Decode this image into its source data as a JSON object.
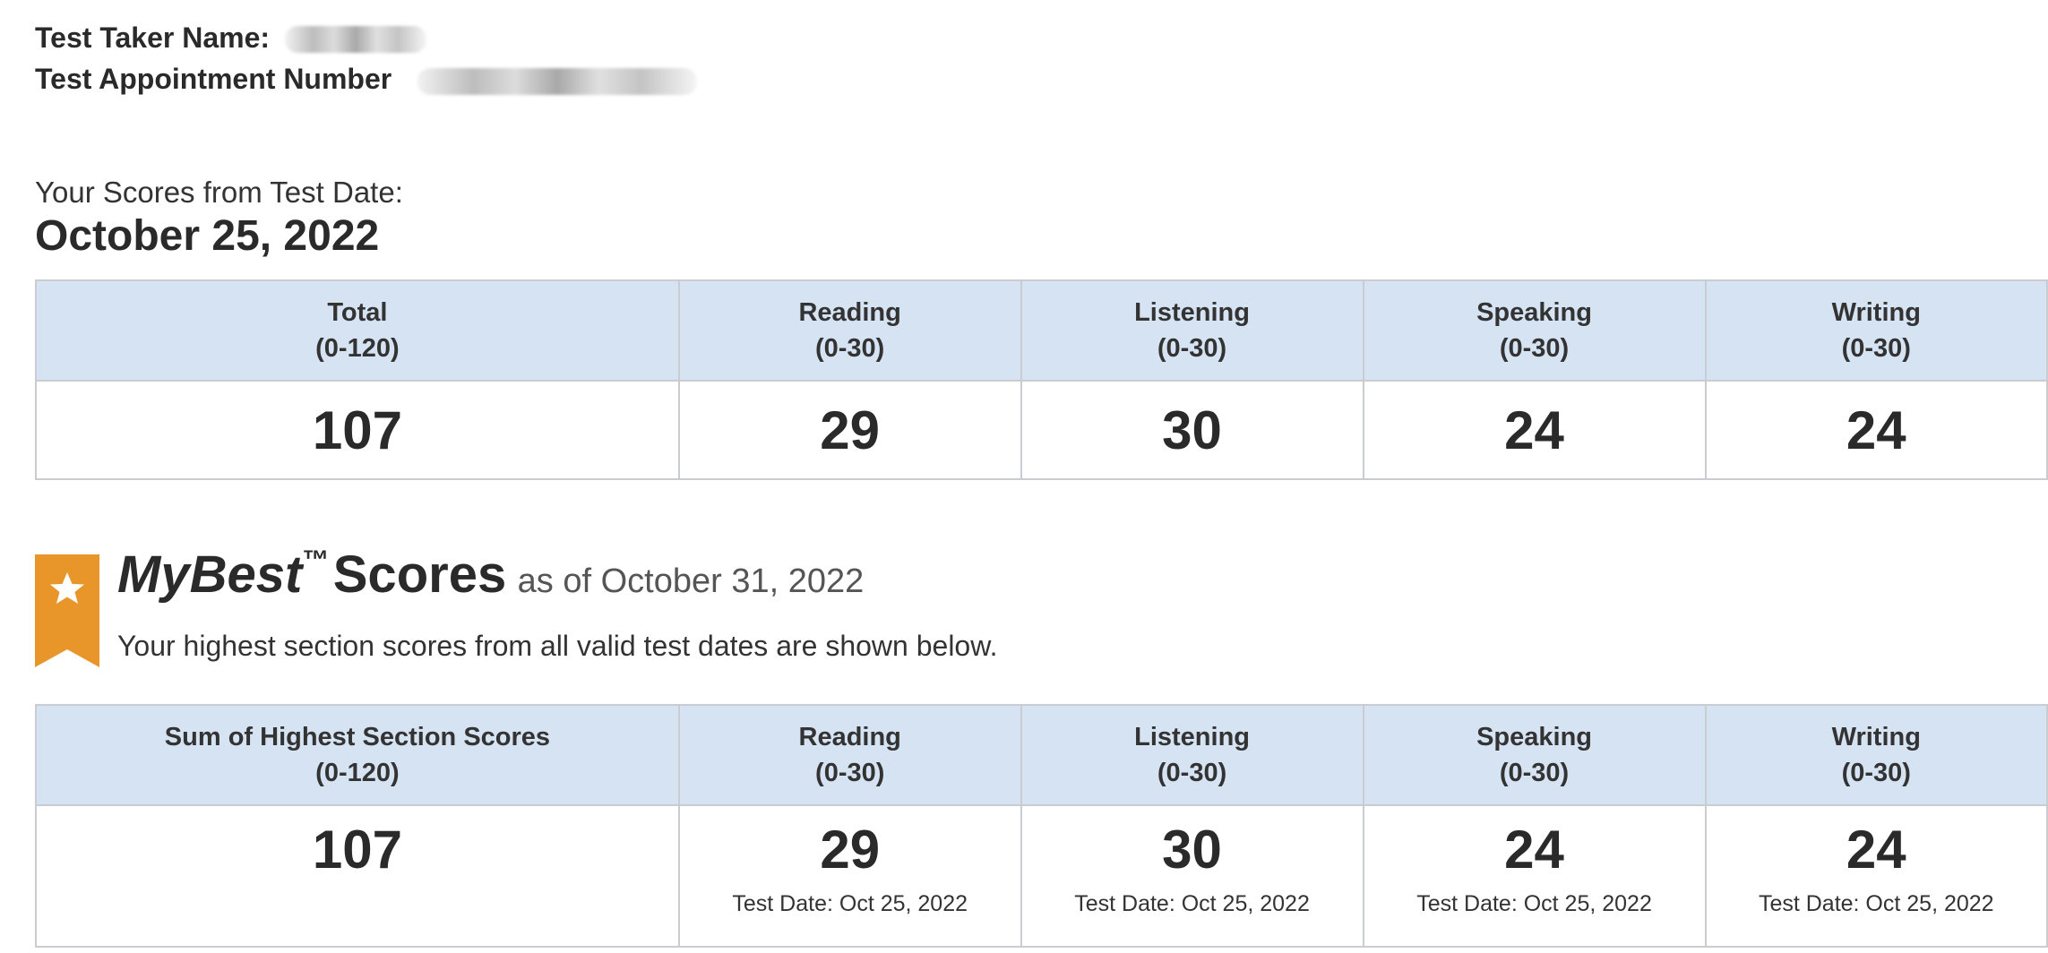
{
  "header": {
    "name_label": "Test Taker Name:",
    "appointment_label": "Test Appointment Number"
  },
  "test_scores": {
    "intro": "Your Scores from Test Date:",
    "date": "October 25, 2022",
    "columns": [
      {
        "title": "Total",
        "range": "(0-120)",
        "score": "107"
      },
      {
        "title": "Reading",
        "range": "(0-30)",
        "score": "29"
      },
      {
        "title": "Listening",
        "range": "(0-30)",
        "score": "30"
      },
      {
        "title": "Speaking",
        "range": "(0-30)",
        "score": "24"
      },
      {
        "title": "Writing",
        "range": "(0-30)",
        "score": "24"
      }
    ]
  },
  "mybest": {
    "title_italic": "MyBest",
    "trademark": "™",
    "title_rest": "Scores",
    "as_of": "as of October 31, 2022",
    "subtitle": "Your highest section scores from all valid test dates are shown below.",
    "ribbon_color": "#e8962a",
    "columns": [
      {
        "title": "Sum of Highest Section Scores",
        "range": "(0-120)",
        "score": "107",
        "test_date": ""
      },
      {
        "title": "Reading",
        "range": "(0-30)",
        "score": "29",
        "test_date": "Test Date: Oct 25, 2022"
      },
      {
        "title": "Listening",
        "range": "(0-30)",
        "score": "30",
        "test_date": "Test Date: Oct 25, 2022"
      },
      {
        "title": "Speaking",
        "range": "(0-30)",
        "score": "24",
        "test_date": "Test Date: Oct 25, 2022"
      },
      {
        "title": "Writing",
        "range": "(0-30)",
        "score": "24",
        "test_date": "Test Date: Oct 25, 2022"
      }
    ]
  },
  "colors": {
    "header_bg": "#d6e3f2",
    "border": "#c9ccd1",
    "text": "#2a2a2a"
  }
}
